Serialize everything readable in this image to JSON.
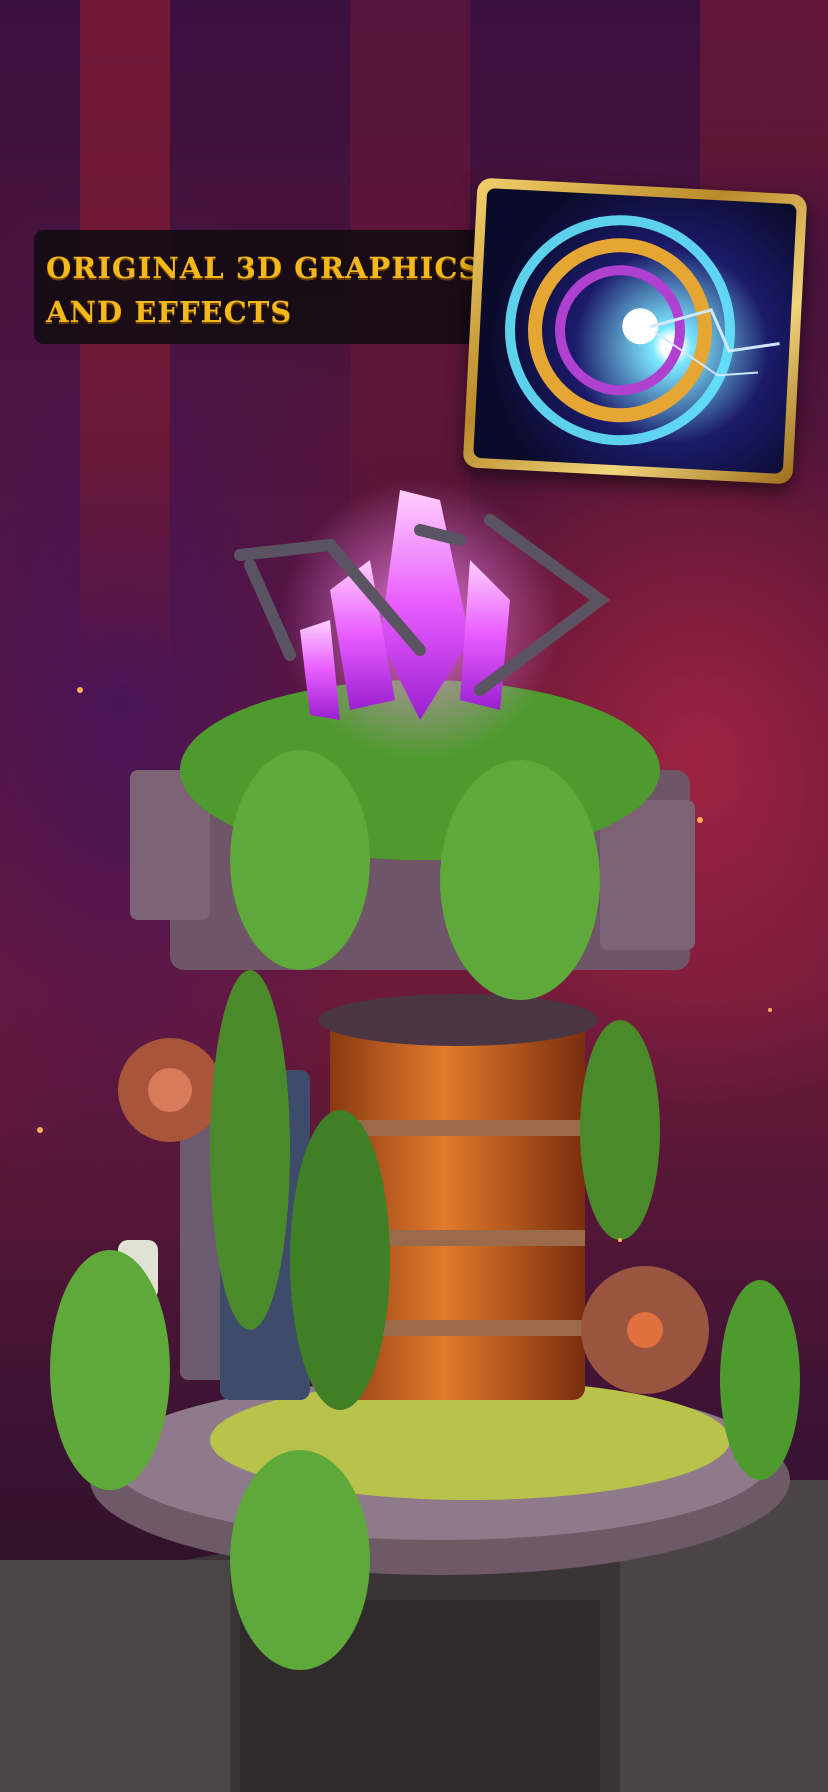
{
  "promo": {
    "headline": "ORIGINAL 3D GRAPHICS\nAND EFFECTS"
  },
  "colors": {
    "headline_text": "#f4b81b",
    "banner_bg": "#140c12",
    "card_frame": "#d9ae4a",
    "crystal": "#e85cff",
    "vines": "#5fa83a",
    "barrel": "#d86a22"
  },
  "icons": {
    "preview_card": "energy-portal-thumbnail",
    "tower": "crystal-tower-illustration"
  }
}
